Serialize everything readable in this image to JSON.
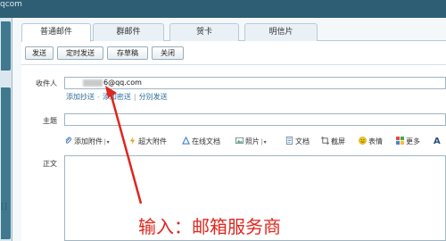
{
  "window": {
    "title_fragment": "qcom"
  },
  "sidebar": {
    "label": "[]"
  },
  "tabs": [
    {
      "label": "普通邮件",
      "active": true
    },
    {
      "label": "群邮件",
      "active": false
    },
    {
      "label": "贺卡",
      "active": false
    },
    {
      "label": "明信片",
      "active": false
    }
  ],
  "toolbar": {
    "send": "发送",
    "scheduled_send": "定时发送",
    "save_draft": "存草稿",
    "close": "关闭"
  },
  "compose": {
    "to_label": "收件人",
    "to_value": "6@qq.com",
    "add_cc": "添加抄送",
    "add_bcc": "添加密送",
    "separate_send": "分别发送",
    "subject_label": "主题",
    "subject_value": "",
    "body_label": "正文"
  },
  "editor_toolbar": {
    "attachment": "添加附件",
    "large_attachment": "超大附件",
    "online_docs": "在线文档",
    "photos": "照片",
    "documents": "文档",
    "screenshot": "截屏",
    "emoji": "表情",
    "more": "更多"
  },
  "annotation": {
    "text": "输入：邮箱服务商",
    "color": "#e0261e"
  },
  "colors": {
    "topbar": "#2e5e74",
    "link": "#2b6b9a"
  }
}
